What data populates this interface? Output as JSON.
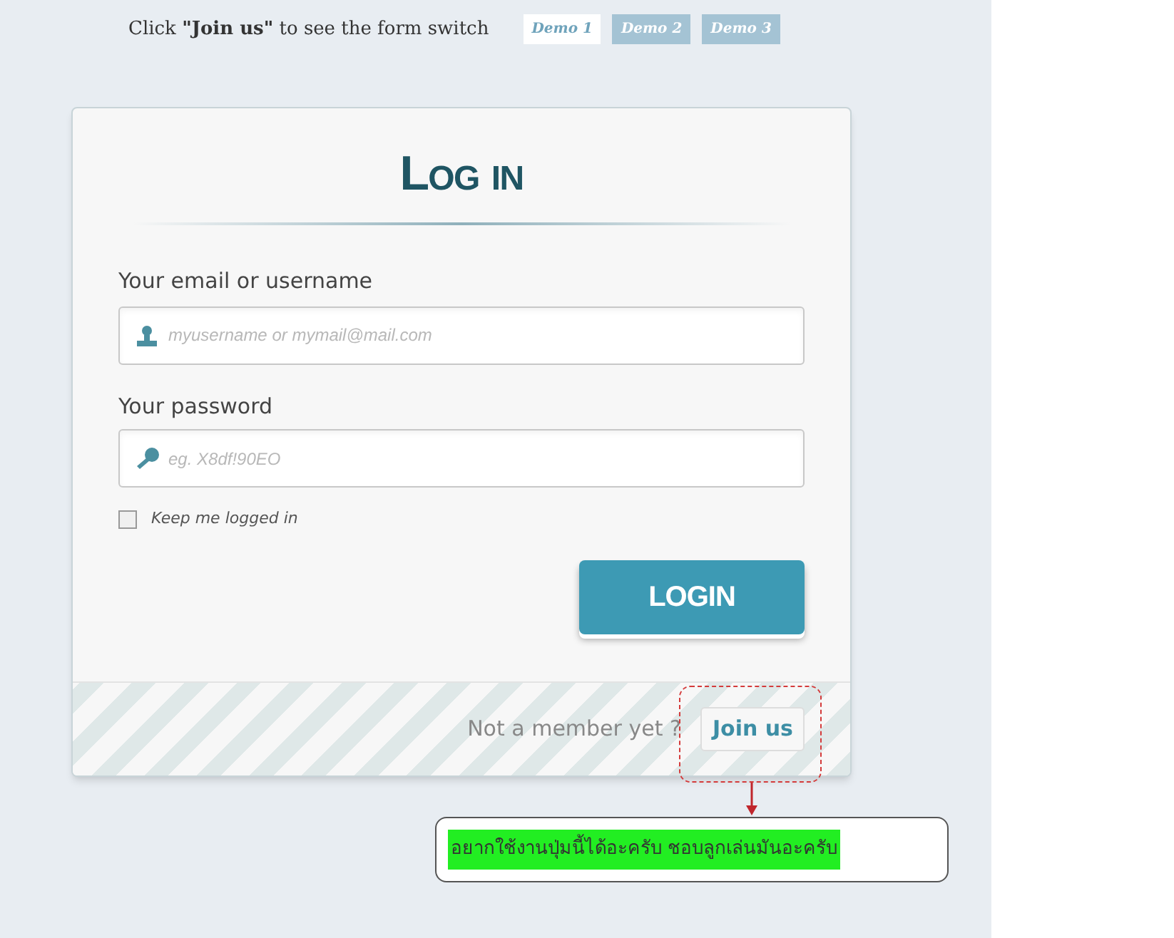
{
  "hint": {
    "before": "Click ",
    "bold": "\"Join us\"",
    "after": " to see the form switch"
  },
  "demos": [
    {
      "label": "Demo 1",
      "selected": true
    },
    {
      "label": "Demo 2",
      "selected": false
    },
    {
      "label": "Demo 3",
      "selected": false
    }
  ],
  "form": {
    "title": "Log in",
    "email_label": "Your email or username",
    "email_placeholder": "myusername or mymail@mail.com",
    "password_label": "Your password",
    "password_placeholder": "eg. X8df!90EO",
    "remember": {
      "label": "Keep me logged in",
      "checked": false
    },
    "submit": "LOGIN"
  },
  "footer": {
    "text": "Not a member yet ?",
    "join": "Join us"
  },
  "annotation": {
    "text": "อยากใช้งานปุ่มนี้ได้อะครับ ชอบลูกเล่นมันอะครับ"
  }
}
